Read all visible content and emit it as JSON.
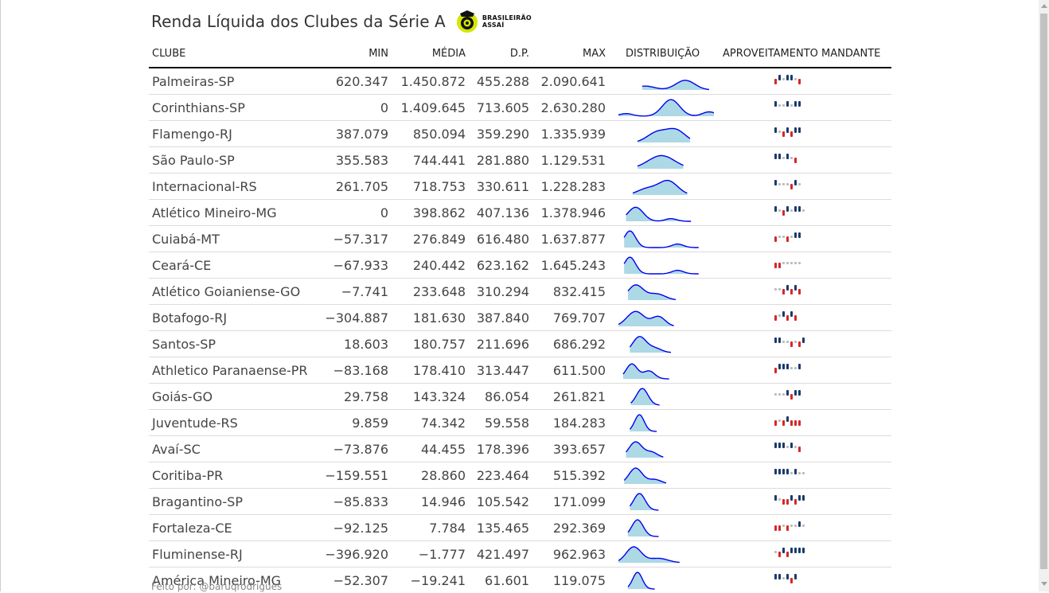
{
  "title": "Renda Líquida dos Clubes da Série A",
  "logo": {
    "line1": "BRASILEIRÃO",
    "line2": "ASSAÍ"
  },
  "headers": {
    "club": "CLUBE",
    "min": "MIN",
    "media": "MÉDIA",
    "dp": "D.P.",
    "max": "MAX",
    "distribution": "DISTRIBUIÇÃO",
    "performance": "APROVEITAMENTO MANDANTE"
  },
  "colors": {
    "curve_line": "#0000ee",
    "curve_fill": "#add8e6",
    "win": "#1a3a6b",
    "draw": "#bbbbbb",
    "loss": "#d62728"
  },
  "rows": [
    {
      "club": "Palmeiras-SP",
      "min": "620.347",
      "media": "1.450.872",
      "dp": "455.288",
      "max": "2.090.641",
      "results": [
        "L",
        "W",
        "D",
        "W",
        "W",
        "D",
        "L"
      ]
    },
    {
      "club": "Corinthians-SP",
      "min": "0",
      "media": "1.409.645",
      "dp": "713.605",
      "max": "2.630.280",
      "results": [
        "W",
        "D",
        "D",
        "W",
        "D",
        "W",
        "W"
      ]
    },
    {
      "club": "Flamengo-RJ",
      "min": "387.079",
      "media": "850.094",
      "dp": "359.290",
      "max": "1.335.939",
      "results": [
        "W",
        "D",
        "L",
        "W",
        "L",
        "W",
        "W"
      ]
    },
    {
      "club": "São Paulo-SP",
      "min": "355.583",
      "media": "744.441",
      "dp": "281.880",
      "max": "1.129.531",
      "results": [
        "W",
        "W",
        "D",
        "W",
        "D",
        "L"
      ]
    },
    {
      "club": "Internacional-RS",
      "min": "261.705",
      "media": "718.753",
      "dp": "330.611",
      "max": "1.228.283",
      "results": [
        "W",
        "D",
        "D",
        "D",
        "L",
        "W",
        "D"
      ]
    },
    {
      "club": "Atlético Mineiro-MG",
      "min": "0",
      "media": "398.862",
      "dp": "407.136",
      "max": "1.378.946",
      "results": [
        "W",
        "D",
        "L",
        "W",
        "D",
        "W",
        "W",
        "D"
      ]
    },
    {
      "club": "Cuiabá-MT",
      "min": "−57.317",
      "media": "276.849",
      "dp": "616.480",
      "max": "1.637.877",
      "results": [
        "L",
        "D",
        "D",
        "L",
        "D",
        "W",
        "W"
      ]
    },
    {
      "club": "Ceará-CE",
      "min": "−67.933",
      "media": "240.442",
      "dp": "623.162",
      "max": "1.645.243",
      "results": [
        "L",
        "L",
        "D",
        "D",
        "D",
        "D",
        "D"
      ]
    },
    {
      "club": "Atlético Goianiense-GO",
      "min": "−7.741",
      "media": "233.648",
      "dp": "310.294",
      "max": "832.415",
      "results": [
        "D",
        "D",
        "L",
        "W",
        "L",
        "W",
        "L"
      ]
    },
    {
      "club": "Botafogo-RJ",
      "min": "−304.887",
      "media": "181.630",
      "dp": "387.840",
      "max": "769.707",
      "results": [
        "L",
        "D",
        "W",
        "L",
        "W",
        "L"
      ]
    },
    {
      "club": "Santos-SP",
      "min": "18.603",
      "media": "180.757",
      "dp": "211.696",
      "max": "686.292",
      "results": [
        "W",
        "W",
        "D",
        "D",
        "L",
        "D",
        "L",
        "W"
      ]
    },
    {
      "club": "Athletico Paranaense-PR",
      "min": "−83.168",
      "media": "178.410",
      "dp": "313.447",
      "max": "611.500",
      "results": [
        "L",
        "W",
        "W",
        "W",
        "D",
        "D",
        "W"
      ]
    },
    {
      "club": "Goiás-GO",
      "min": "29.758",
      "media": "143.324",
      "dp": "86.054",
      "max": "261.821",
      "results": [
        "D",
        "D",
        "D",
        "W",
        "L",
        "W",
        "W"
      ]
    },
    {
      "club": "Juventude-RS",
      "min": "9.859",
      "media": "74.342",
      "dp": "59.558",
      "max": "184.283",
      "results": [
        "L",
        "D",
        "L",
        "W",
        "L",
        "L",
        "L"
      ]
    },
    {
      "club": "Avaí-SC",
      "min": "−73.876",
      "media": "44.455",
      "dp": "178.396",
      "max": "393.657",
      "results": [
        "W",
        "W",
        "W",
        "D",
        "W",
        "D",
        "L"
      ]
    },
    {
      "club": "Coritiba-PR",
      "min": "−159.551",
      "media": "28.860",
      "dp": "223.464",
      "max": "515.392",
      "results": [
        "W",
        "W",
        "W",
        "W",
        "D",
        "W",
        "D",
        "D"
      ]
    },
    {
      "club": "Bragantino-SP",
      "min": "−85.833",
      "media": "14.946",
      "dp": "105.542",
      "max": "171.099",
      "results": [
        "W",
        "D",
        "L",
        "L",
        "W",
        "L",
        "W",
        "W"
      ]
    },
    {
      "club": "Fortaleza-CE",
      "min": "−92.125",
      "media": "7.784",
      "dp": "135.465",
      "max": "292.369",
      "results": [
        "L",
        "L",
        "D",
        "L",
        "D",
        "D",
        "W",
        "D"
      ]
    },
    {
      "club": "Fluminense-RJ",
      "min": "−396.920",
      "media": "−1.777",
      "dp": "421.497",
      "max": "962.963",
      "results": [
        "D",
        "L",
        "W",
        "L",
        "W",
        "W",
        "W",
        "W"
      ]
    },
    {
      "club": "América Mineiro-MG",
      "min": "−52.307",
      "media": "−19.241",
      "dp": "61.601",
      "max": "119.075",
      "results": [
        "W",
        "W",
        "D",
        "W",
        "L",
        "W"
      ]
    }
  ],
  "distributions": [
    {
      "peaks": [
        [
          0.28,
          0.22,
          0.1
        ],
        [
          0.7,
          0.55,
          0.1
        ]
      ],
      "range": [
        0.25,
        0.95
      ]
    },
    {
      "peaks": [
        [
          0.08,
          0.15,
          0.07
        ],
        [
          0.55,
          0.95,
          0.09
        ],
        [
          0.95,
          0.25,
          0.07
        ]
      ],
      "range": [
        0.0,
        1.0
      ]
    },
    {
      "peaks": [
        [
          0.4,
          0.55,
          0.1
        ],
        [
          0.6,
          0.7,
          0.1
        ]
      ],
      "range": [
        0.2,
        0.75
      ]
    },
    {
      "peaks": [
        [
          0.45,
          0.75,
          0.14
        ]
      ],
      "range": [
        0.2,
        0.68
      ]
    },
    {
      "peaks": [
        [
          0.3,
          0.35,
          0.1
        ],
        [
          0.52,
          0.8,
          0.1
        ]
      ],
      "range": [
        0.15,
        0.72
      ]
    },
    {
      "peaks": [
        [
          0.18,
          0.8,
          0.08
        ],
        [
          0.55,
          0.15,
          0.06
        ]
      ],
      "range": [
        0.08,
        0.76
      ]
    },
    {
      "peaks": [
        [
          0.12,
          0.95,
          0.06
        ],
        [
          0.62,
          0.2,
          0.06
        ]
      ],
      "range": [
        0.06,
        0.84
      ]
    },
    {
      "peaks": [
        [
          0.12,
          0.95,
          0.06
        ],
        [
          0.62,
          0.2,
          0.06
        ]
      ],
      "range": [
        0.06,
        0.84
      ]
    },
    {
      "peaks": [
        [
          0.18,
          0.85,
          0.08
        ],
        [
          0.4,
          0.35,
          0.09
        ]
      ],
      "range": [
        0.1,
        0.6
      ]
    },
    {
      "peaks": [
        [
          0.18,
          0.85,
          0.09
        ],
        [
          0.42,
          0.55,
          0.07
        ]
      ],
      "range": [
        0.0,
        0.58
      ]
    },
    {
      "peaks": [
        [
          0.22,
          0.9,
          0.07
        ],
        [
          0.38,
          0.25,
          0.07
        ]
      ],
      "range": [
        0.12,
        0.55
      ]
    },
    {
      "peaks": [
        [
          0.14,
          0.85,
          0.06
        ],
        [
          0.32,
          0.45,
          0.06
        ]
      ],
      "range": [
        0.05,
        0.53
      ]
    },
    {
      "peaks": [
        [
          0.25,
          0.95,
          0.06
        ]
      ],
      "range": [
        0.13,
        0.43
      ]
    },
    {
      "peaks": [
        [
          0.22,
          0.95,
          0.05
        ]
      ],
      "range": [
        0.12,
        0.4
      ]
    },
    {
      "peaks": [
        [
          0.18,
          0.9,
          0.07
        ],
        [
          0.35,
          0.3,
          0.06
        ]
      ],
      "range": [
        0.08,
        0.47
      ]
    },
    {
      "peaks": [
        [
          0.18,
          0.9,
          0.07
        ],
        [
          0.38,
          0.25,
          0.07
        ]
      ],
      "range": [
        0.06,
        0.5
      ]
    },
    {
      "peaks": [
        [
          0.22,
          0.95,
          0.06
        ]
      ],
      "range": [
        0.12,
        0.42
      ]
    },
    {
      "peaks": [
        [
          0.2,
          0.95,
          0.06
        ]
      ],
      "range": [
        0.1,
        0.42
      ]
    },
    {
      "peaks": [
        [
          0.16,
          0.9,
          0.08
        ],
        [
          0.42,
          0.25,
          0.1
        ]
      ],
      "range": [
        0.0,
        0.64
      ]
    },
    {
      "peaks": [
        [
          0.2,
          0.95,
          0.05
        ]
      ],
      "range": [
        0.1,
        0.38
      ]
    }
  ],
  "footer": "Feito por: @baruqrodrigues"
}
